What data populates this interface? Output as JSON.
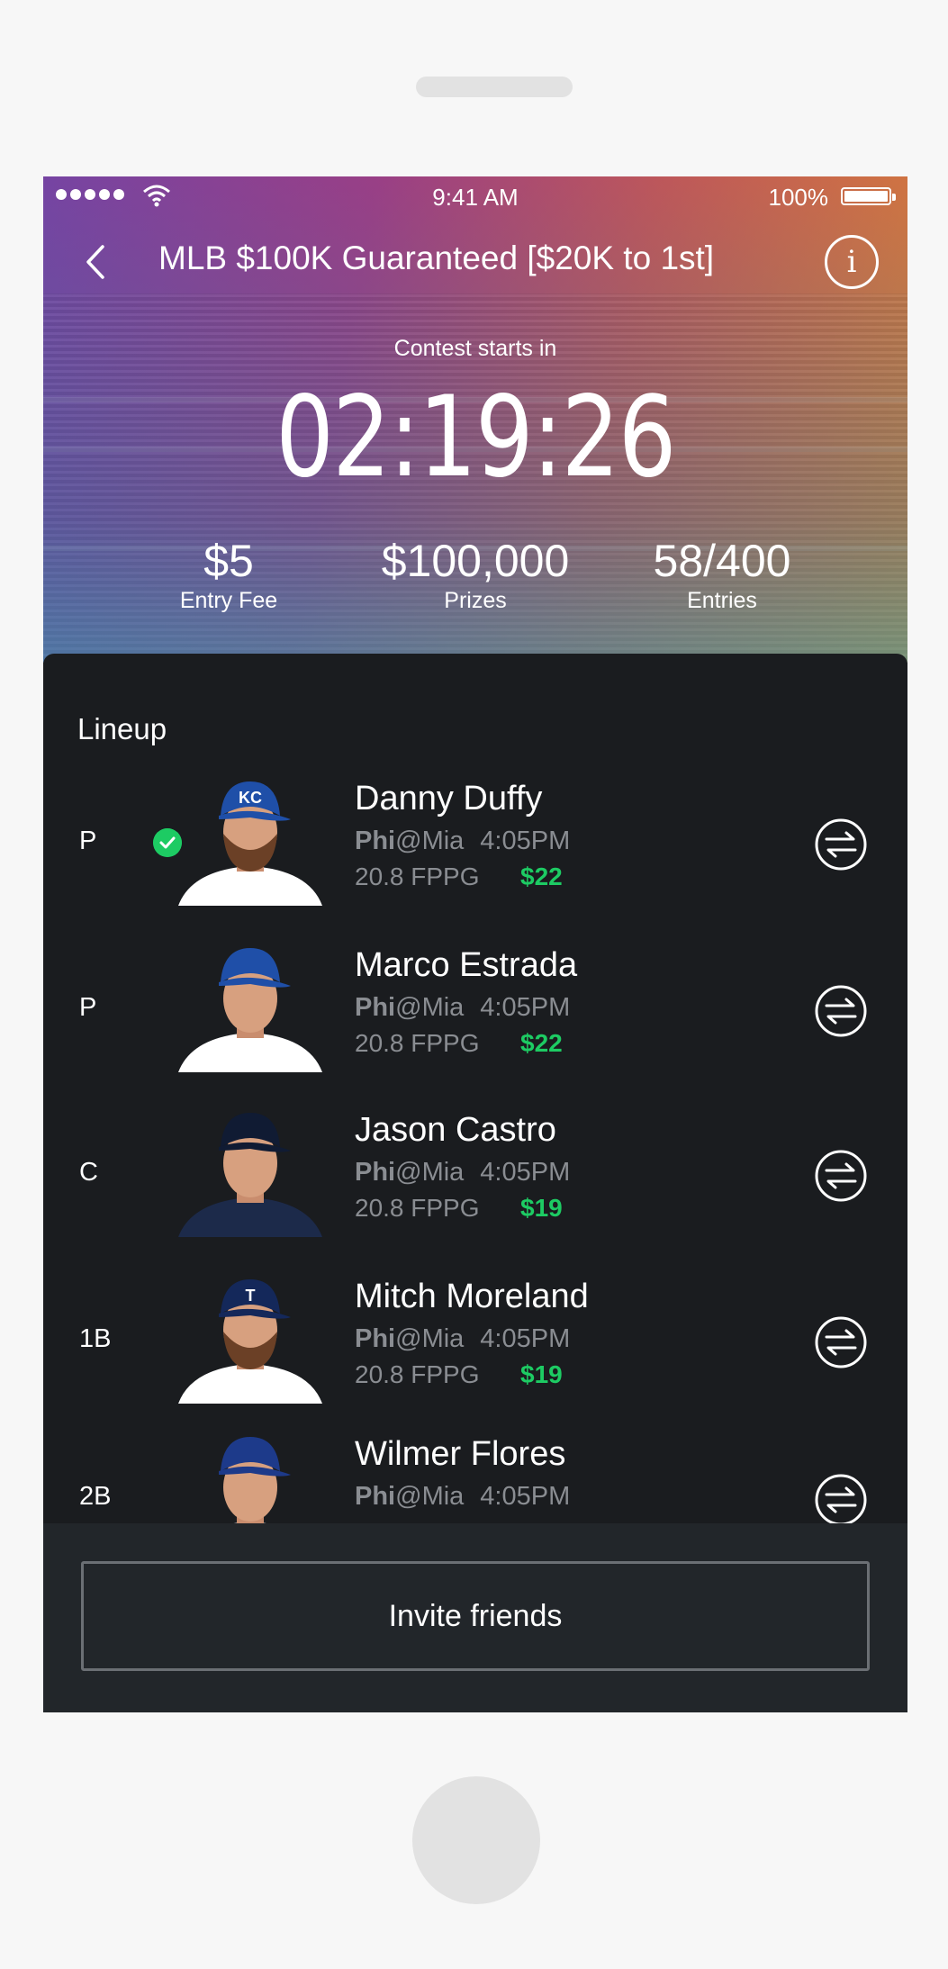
{
  "status_bar": {
    "time": "9:41 AM",
    "battery": "100%"
  },
  "header": {
    "title": "MLB $100K Guaranteed [$20K to 1st]",
    "starts_label": "Contest starts in",
    "countdown": "02:19:26"
  },
  "stats": [
    {
      "value": "$5",
      "label": "Entry Fee"
    },
    {
      "value": "$100,000",
      "label": "Prizes"
    },
    {
      "value": "58/400",
      "label": "Entries"
    }
  ],
  "lineup": {
    "title": "Lineup",
    "players": [
      {
        "position": "P",
        "name": "Danny Duffy",
        "team": "Phi",
        "opponent": "@Mia",
        "time": "4:05PM",
        "fppg": "20.8 FPPG",
        "salary": "$22",
        "selected": true,
        "cap_color": "#1f4fa8",
        "cap_logo": "KC",
        "jersey_color": "#ffffff",
        "beard": true
      },
      {
        "position": "P",
        "name": "Marco Estrada",
        "team": "Phi",
        "opponent": "@Mia",
        "time": "4:05PM",
        "fppg": "20.8 FPPG",
        "salary": "$22",
        "selected": false,
        "cap_color": "#1f4fa8",
        "cap_logo": "",
        "jersey_color": "#ffffff",
        "beard": false
      },
      {
        "position": "C",
        "name": "Jason Castro",
        "team": "Phi",
        "opponent": "@Mia",
        "time": "4:05PM",
        "fppg": "20.8 FPPG",
        "salary": "$19",
        "selected": false,
        "cap_color": "#101b33",
        "cap_logo": "",
        "jersey_color": "#1c2a4a",
        "beard": false
      },
      {
        "position": "1B",
        "name": "Mitch Moreland",
        "team": "Phi",
        "opponent": "@Mia",
        "time": "4:05PM",
        "fppg": "20.8 FPPG",
        "salary": "$19",
        "selected": false,
        "cap_color": "#14285a",
        "cap_logo": "T",
        "jersey_color": "#ffffff",
        "beard": true
      },
      {
        "position": "2B",
        "name": "Wilmer Flores",
        "team": "Phi",
        "opponent": "@Mia",
        "time": "4:05PM",
        "fppg": "",
        "salary": "",
        "selected": false,
        "cap_color": "#1d3a8a",
        "cap_logo": "",
        "jersey_color": "#ffffff",
        "beard": false
      }
    ]
  },
  "footer": {
    "invite_label": "Invite friends"
  },
  "colors": {
    "accent_green": "#1dcb63",
    "panel_bg": "#1a1c1f",
    "footer_bg": "#22262a"
  }
}
